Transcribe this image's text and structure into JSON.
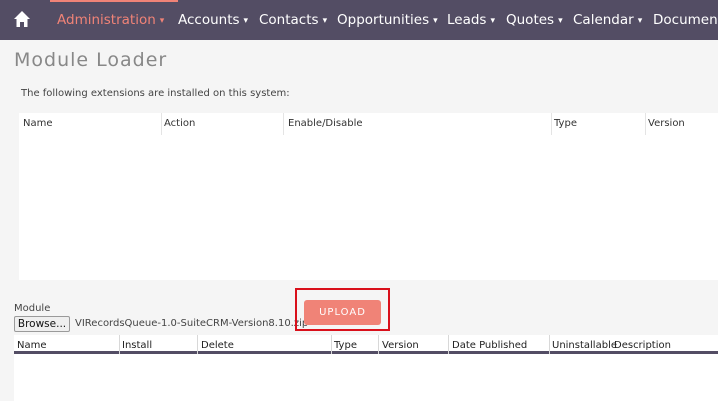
{
  "nav": {
    "items": [
      {
        "label": "Administration",
        "active": true
      },
      {
        "label": "Accounts"
      },
      {
        "label": "Contacts"
      },
      {
        "label": "Opportunities"
      },
      {
        "label": "Leads"
      },
      {
        "label": "Quotes"
      },
      {
        "label": "Calendar"
      },
      {
        "label": "Document"
      }
    ]
  },
  "page": {
    "title": "Module Loader",
    "intro": "The following extensions are installed on this system:"
  },
  "installed_table": {
    "headers": [
      "Name",
      "Action",
      "Enable/Disable",
      "Type",
      "Version"
    ]
  },
  "upload": {
    "module_label": "Module",
    "browse_label": "Browse...",
    "filename": "VIRecordsQueue-1.0-SuiteCRM-Version8.10.zip",
    "upload_label": "UPLOAD"
  },
  "package_table": {
    "headers": [
      "Name",
      "Install",
      "Delete",
      "Type",
      "Version",
      "Date Published",
      "Uninstallable",
      "Description"
    ]
  },
  "colors": {
    "nav_bg": "#534d64",
    "accent": "#f08377",
    "highlight": "#d9101b"
  }
}
